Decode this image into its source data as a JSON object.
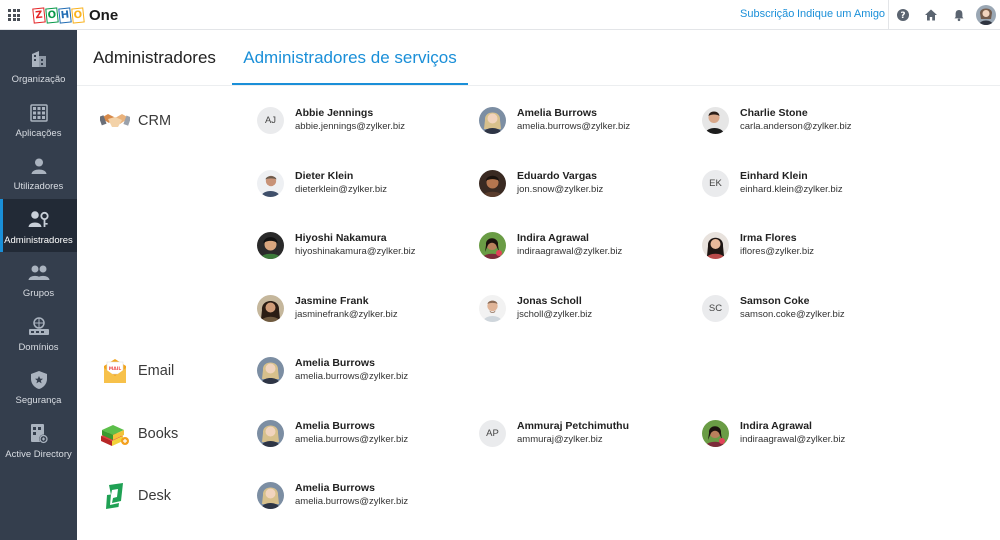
{
  "app": {
    "brand_letters": [
      "Z",
      "O",
      "H",
      "O"
    ],
    "brand_letter_colors": [
      "#e42527",
      "#089949",
      "#226db4",
      "#f9b21d"
    ],
    "product": "One"
  },
  "header": {
    "links": [
      "Subscrição",
      "Indique um Amigo"
    ],
    "icons": [
      "help-icon",
      "home-icon",
      "bell-icon",
      "user-avatar"
    ]
  },
  "sidebar": {
    "items": [
      {
        "label": "Organização",
        "icon": "building-icon",
        "active": false
      },
      {
        "label": "Aplicações",
        "icon": "apps-grid-icon",
        "active": false
      },
      {
        "label": "Utilizadores",
        "icon": "user-icon",
        "active": false
      },
      {
        "label": "Administradores",
        "icon": "admin-key-icon",
        "active": true
      },
      {
        "label": "Grupos",
        "icon": "group-icon",
        "active": false
      },
      {
        "label": "Domínios",
        "icon": "domain-icon",
        "active": false
      },
      {
        "label": "Segurança",
        "icon": "shield-icon",
        "active": false
      },
      {
        "label": "Active Directory",
        "icon": "active-directory-icon",
        "active": false
      }
    ]
  },
  "tabs": [
    {
      "label": "Administradores",
      "active": false
    },
    {
      "label": "Administradores de serviços",
      "active": true
    }
  ],
  "services": [
    {
      "name": "CRM",
      "icon": "crm-handshake-icon"
    },
    {
      "name": "Email",
      "icon": "mail-envelope-icon"
    },
    {
      "name": "Books",
      "icon": "books-icon"
    },
    {
      "name": "Desk",
      "icon": "desk-icon"
    }
  ],
  "admins": [
    {
      "name": "Abbie Jennings",
      "email": "abbie.jennings@zylker.biz",
      "initials": "AJ"
    },
    {
      "name": "Amelia Burrows",
      "email": "amelia.burrows@zylker.biz"
    },
    {
      "name": "Charlie Stone",
      "email": "carla.anderson@zylker.biz"
    },
    {
      "name": "Dieter Klein",
      "email": "dieterklein@zylker.biz"
    },
    {
      "name": "Eduardo Vargas",
      "email": "jon.snow@zylker.biz"
    },
    {
      "name": "Einhard Klein",
      "email": "einhard.klein@zylker.biz",
      "initials": "EK"
    },
    {
      "name": "Hiyoshi Nakamura",
      "email": "hiyoshinakamura@zylker.biz"
    },
    {
      "name": "Indira Agrawal",
      "email": "indiraagrawal@zylker.biz"
    },
    {
      "name": "Irma Flores",
      "email": "iflores@zylker.biz"
    },
    {
      "name": "Jasmine Frank",
      "email": "jasminefrank@zylker.biz"
    },
    {
      "name": "Jonas Scholl",
      "email": "jscholl@zylker.biz"
    },
    {
      "name": "Samson Coke",
      "email": "samson.coke@zylker.biz",
      "initials": "SC"
    },
    {
      "name": "Amelia Burrows",
      "email": "amelia.burrows@zylker.biz"
    },
    {
      "name": "Amelia Burrows",
      "email": "amelia.burrows@zylker.biz"
    },
    {
      "name": "Ammuraj Petchimuthu",
      "email": "ammuraj@zylker.biz",
      "initials": "AP"
    },
    {
      "name": "Indira Agrawal",
      "email": "indiraagrawal@zylker.biz"
    },
    {
      "name": "Amelia Burrows",
      "email": "amelia.burrows@zylker.biz"
    }
  ],
  "colors": {
    "accent": "#1a8fd8",
    "sidebar_bg": "#343e4d",
    "sidebar_active": "#222a36"
  }
}
